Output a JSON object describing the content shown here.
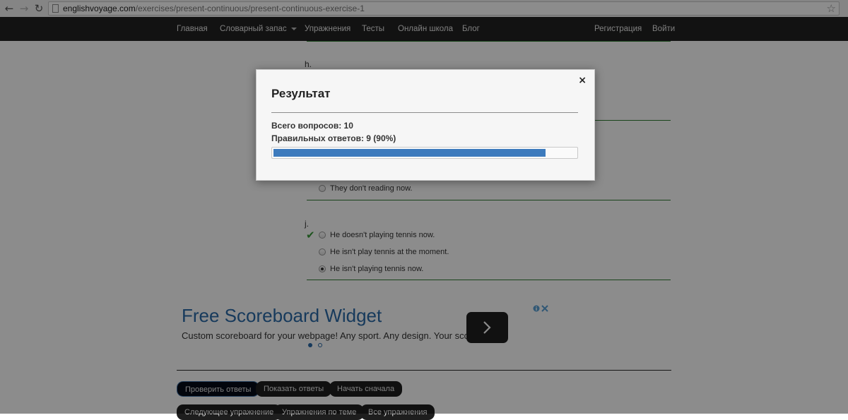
{
  "browser": {
    "url_host": "englishvoyage.com",
    "url_path": "/exercises/present-continuous/present-continuous-exercise-1"
  },
  "navbar": {
    "items": [
      "Главная",
      "Словарный запас",
      "Упражнения",
      "Тесты",
      "Онлайн школа",
      "Блог"
    ],
    "right": [
      "Регистрация",
      "Войти"
    ]
  },
  "questions": [
    {
      "letter": "h."
    },
    {
      "options": [
        {
          "text": "They don't reading now.",
          "selected": false
        }
      ]
    },
    {
      "letter": "j.",
      "options": [
        {
          "text": "He doesn't playing tennis now.",
          "selected": false
        },
        {
          "text": "He isn't play tennis at the moment.",
          "selected": false
        },
        {
          "text": "He isn't playing tennis now.",
          "selected": true
        }
      ]
    }
  ],
  "ad": {
    "title": "Free Scoreboard Widget",
    "description": "Custom scoreboard for your webpage! Any sport. Any design. Your score."
  },
  "buttons": {
    "row1": [
      "Проверить ответы",
      "Показать ответы",
      "Начать сначала"
    ],
    "row2": [
      "Следующее упражнение",
      "Упражнения по теме",
      "Все упражнения"
    ]
  },
  "modal": {
    "title": "Результат",
    "close": "×",
    "total": "Всего вопросов: 10",
    "correct": "Правильных ответов: 9 (90%)",
    "progress_fraction": 0.9
  },
  "colors": {
    "navbar": "#222222",
    "progress": "#3d7bbd",
    "separator": "#2e7d32",
    "ad_title": "#2a6aa8"
  }
}
